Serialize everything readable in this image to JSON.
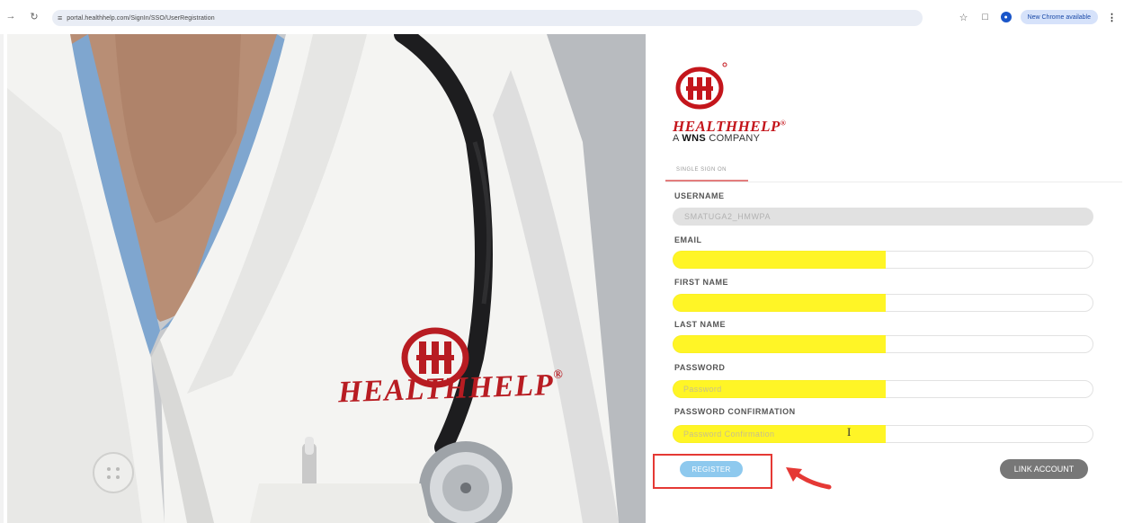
{
  "browser": {
    "url": "portal.healthhelp.com/SignIn/SSO/UserRegistration",
    "update_label": "New Chrome available",
    "icons": [
      "forward-icon",
      "reload-icon",
      "site-info-icon",
      "bookmark-star-icon",
      "extensions-icon",
      "profile-icon",
      "menu-icon"
    ]
  },
  "hero": {
    "brand_text": "HEALTHHELP",
    "registered_mark": "®"
  },
  "logo": {
    "brand": "HEALTHHELP",
    "registered_mark": "®",
    "company_prefix": "A",
    "company_bold": "WNS",
    "company_suffix": "COMPANY"
  },
  "tab": {
    "label": "SINGLE SIGN ON"
  },
  "form": {
    "username": {
      "label": "USERNAME",
      "value": "SMATUGA2_HMWPA"
    },
    "email": {
      "label": "EMAIL",
      "value": ""
    },
    "first_name": {
      "label": "FIRST NAME",
      "value": ""
    },
    "last_name": {
      "label": "LAST NAME",
      "value": ""
    },
    "password": {
      "label": "PASSWORD",
      "placeholder": "Password"
    },
    "password_confirmation": {
      "label": "PASSWORD CONFIRMATION",
      "placeholder": "Password Confirmation"
    }
  },
  "buttons": {
    "register": "REGISTER",
    "link_account": "LINK ACCOUNT"
  },
  "colors": {
    "brand_red": "#c4161c",
    "highlight_yellow": "#fff300",
    "register_blue": "#8ec9ee",
    "annotation_red": "#e53935"
  }
}
